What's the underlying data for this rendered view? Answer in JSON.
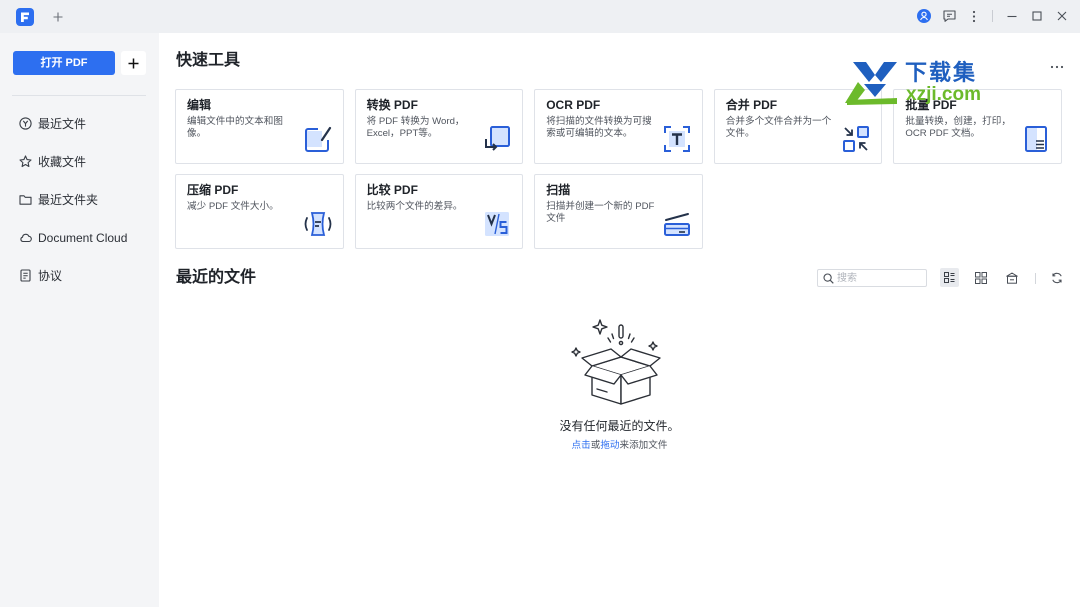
{
  "titlebar": {
    "icons": {
      "app": "pdfelement-logo-icon",
      "new_tab": "plus-icon",
      "account": "account-icon",
      "feedback": "feedback-icon",
      "more": "more-vertical-icon",
      "minimize": "minimize-icon",
      "maximize": "maximize-icon",
      "close": "close-icon"
    }
  },
  "sidebar": {
    "open_pdf_label": "打开 PDF",
    "add_icon": "plus-icon",
    "items": [
      {
        "label": "最近文件",
        "icon": "recent-icon"
      },
      {
        "label": "收藏文件",
        "icon": "star-icon"
      },
      {
        "label": "最近文件夹",
        "icon": "folder-icon"
      },
      {
        "label": "Document Cloud",
        "icon": "cloud-icon"
      },
      {
        "label": "协议",
        "icon": "agreement-icon"
      }
    ]
  },
  "quick_tools": {
    "title": "快速工具",
    "more_icon": "more-horizontal-icon",
    "tools": [
      {
        "title": "编辑",
        "desc": "编辑文件中的文本和图像。",
        "icon": "edit-icon"
      },
      {
        "title": "转换 PDF",
        "desc": "将 PDF 转换为 Word，Excel，PPT等。",
        "icon": "convert-icon"
      },
      {
        "title": "OCR PDF",
        "desc": "将扫描的文件转换为可搜索或可编辑的文本。",
        "icon": "ocr-icon"
      },
      {
        "title": "合并 PDF",
        "desc": "合并多个文件合并为一个文件。",
        "icon": "merge-icon"
      },
      {
        "title": "批量 PDF",
        "desc": "批量转换，创建，打印，OCR PDF 文档。",
        "icon": "batch-icon"
      },
      {
        "title": "压缩 PDF",
        "desc": "减少 PDF 文件大小。",
        "icon": "compress-icon"
      },
      {
        "title": "比较 PDF",
        "desc": "比较两个文件的差异。",
        "icon": "compare-icon"
      },
      {
        "title": "扫描",
        "desc": "扫描并创建一个新的 PDF 文件",
        "icon": "scan-icon"
      }
    ]
  },
  "recent_files": {
    "title": "最近的文件",
    "search_placeholder": "搜索",
    "view_icons": [
      "list-view-icon",
      "grid-view-icon",
      "storage-icon",
      "refresh-icon"
    ],
    "empty_title": "没有任何最近的文件。",
    "empty_hint": {
      "click": "点击",
      "or": "或",
      "drag": "拖动",
      "rest": "来添加文件"
    },
    "illustration": "empty-box-illustration"
  },
  "watermark": {
    "brand": "下载集",
    "domain": "xzji.com"
  },
  "colors": {
    "primary": "#2d6ff0",
    "icon_blue": "#2a5fd8",
    "icon_fill": "#d4e3ff",
    "titlebar_bg": "#eef0f3",
    "sidebar_bg": "#f4f5f7",
    "text": "#1f2329",
    "watermark_blue": "#1f5fbf",
    "watermark_green": "#6cba2b"
  }
}
